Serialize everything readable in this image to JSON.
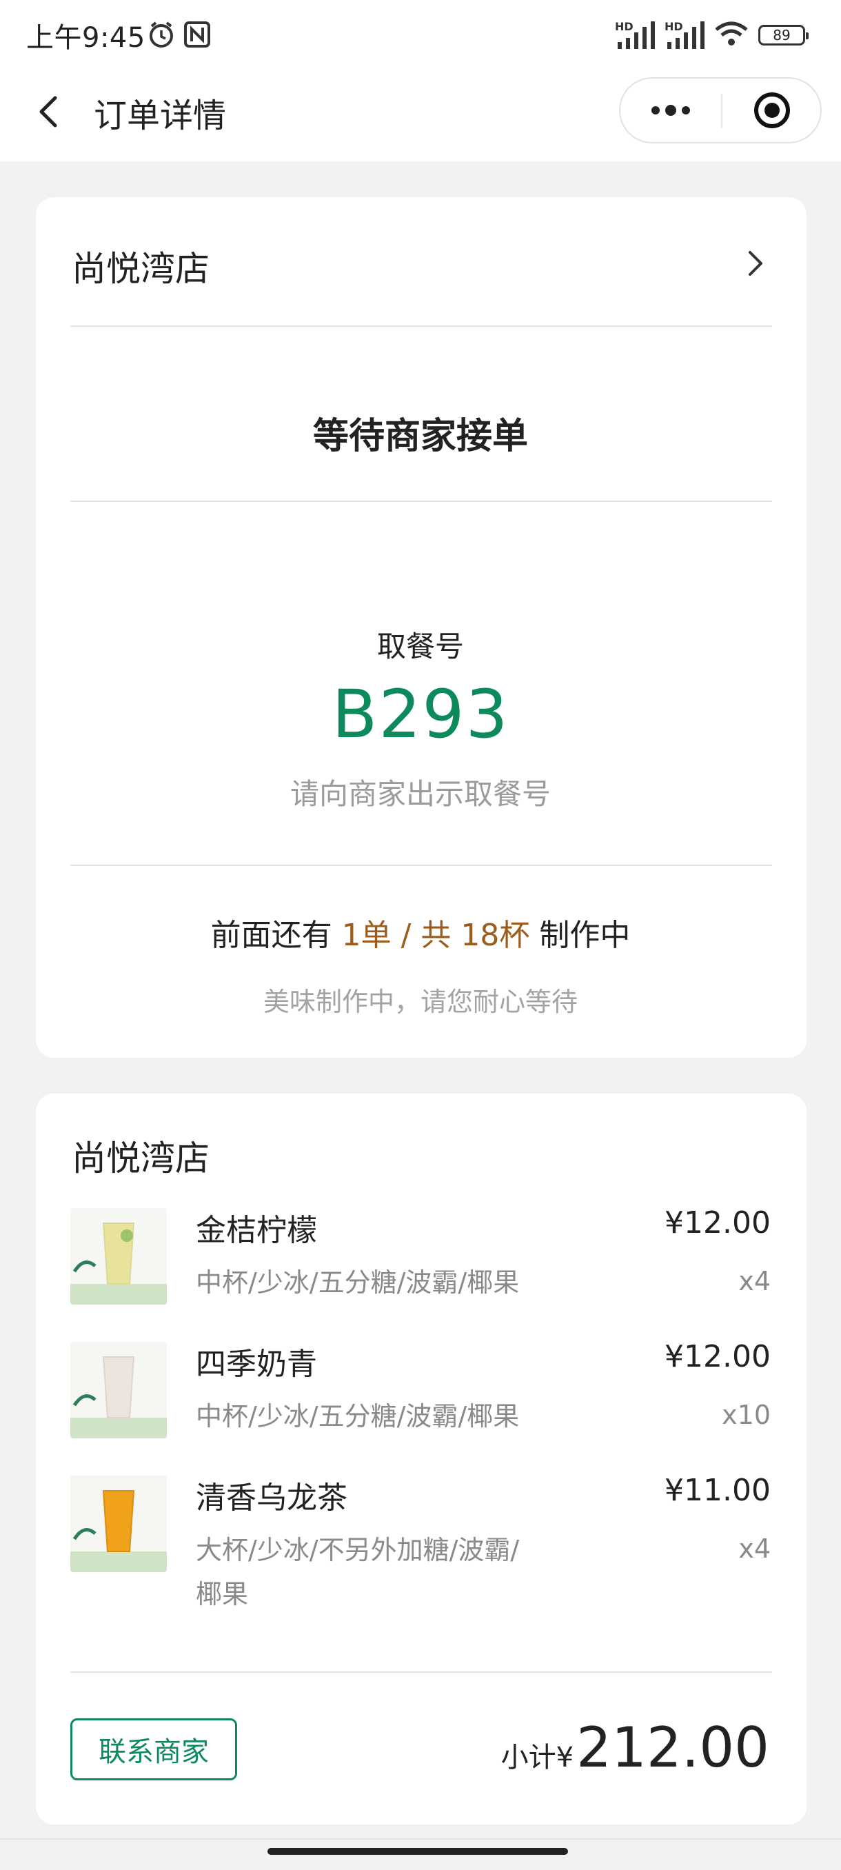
{
  "status_bar": {
    "time": "上午9:45",
    "battery": "89",
    "signal_label_1": "HD",
    "signal_label_2": "HD"
  },
  "nav": {
    "title": "订单详情",
    "icons": [
      "back-arrow-icon",
      "more-dots-icon",
      "close-target-icon"
    ]
  },
  "order": {
    "store_name": "尚悦湾店",
    "status": "等待商家接单",
    "pickup_label": "取餐号",
    "pickup_number": "B293",
    "pickup_hint": "请向商家出示取餐号",
    "queue_prefix": "前面还有",
    "queue_highlight": "1单 / 共 18杯",
    "queue_suffix": "制作中",
    "queue_sub": "美味制作中，请您耐心等待"
  },
  "items_section": {
    "store_name": "尚悦湾店",
    "items": [
      {
        "name": "金桔柠檬",
        "options": "中杯/少冰/五分糖/波霸/椰果",
        "price": "¥12.00",
        "qty": "x4",
        "drink_color": "#e8e39a"
      },
      {
        "name": "四季奶青",
        "options": "中杯/少冰/五分糖/波霸/椰果",
        "price": "¥12.00",
        "qty": "x10",
        "drink_color": "#ece5de"
      },
      {
        "name": "清香乌龙茶",
        "options": "大杯/少冰/不另外加糖/波霸/\n椰果",
        "price": "¥11.00",
        "qty": "x4",
        "drink_color": "#f0a21a"
      }
    ],
    "contact_button": "联系商家",
    "subtotal_label": "小计¥",
    "subtotal_amount": "212.00"
  },
  "colors": {
    "accent_green": "#0c8a5c",
    "highlight_brown": "#9b5d1d"
  }
}
